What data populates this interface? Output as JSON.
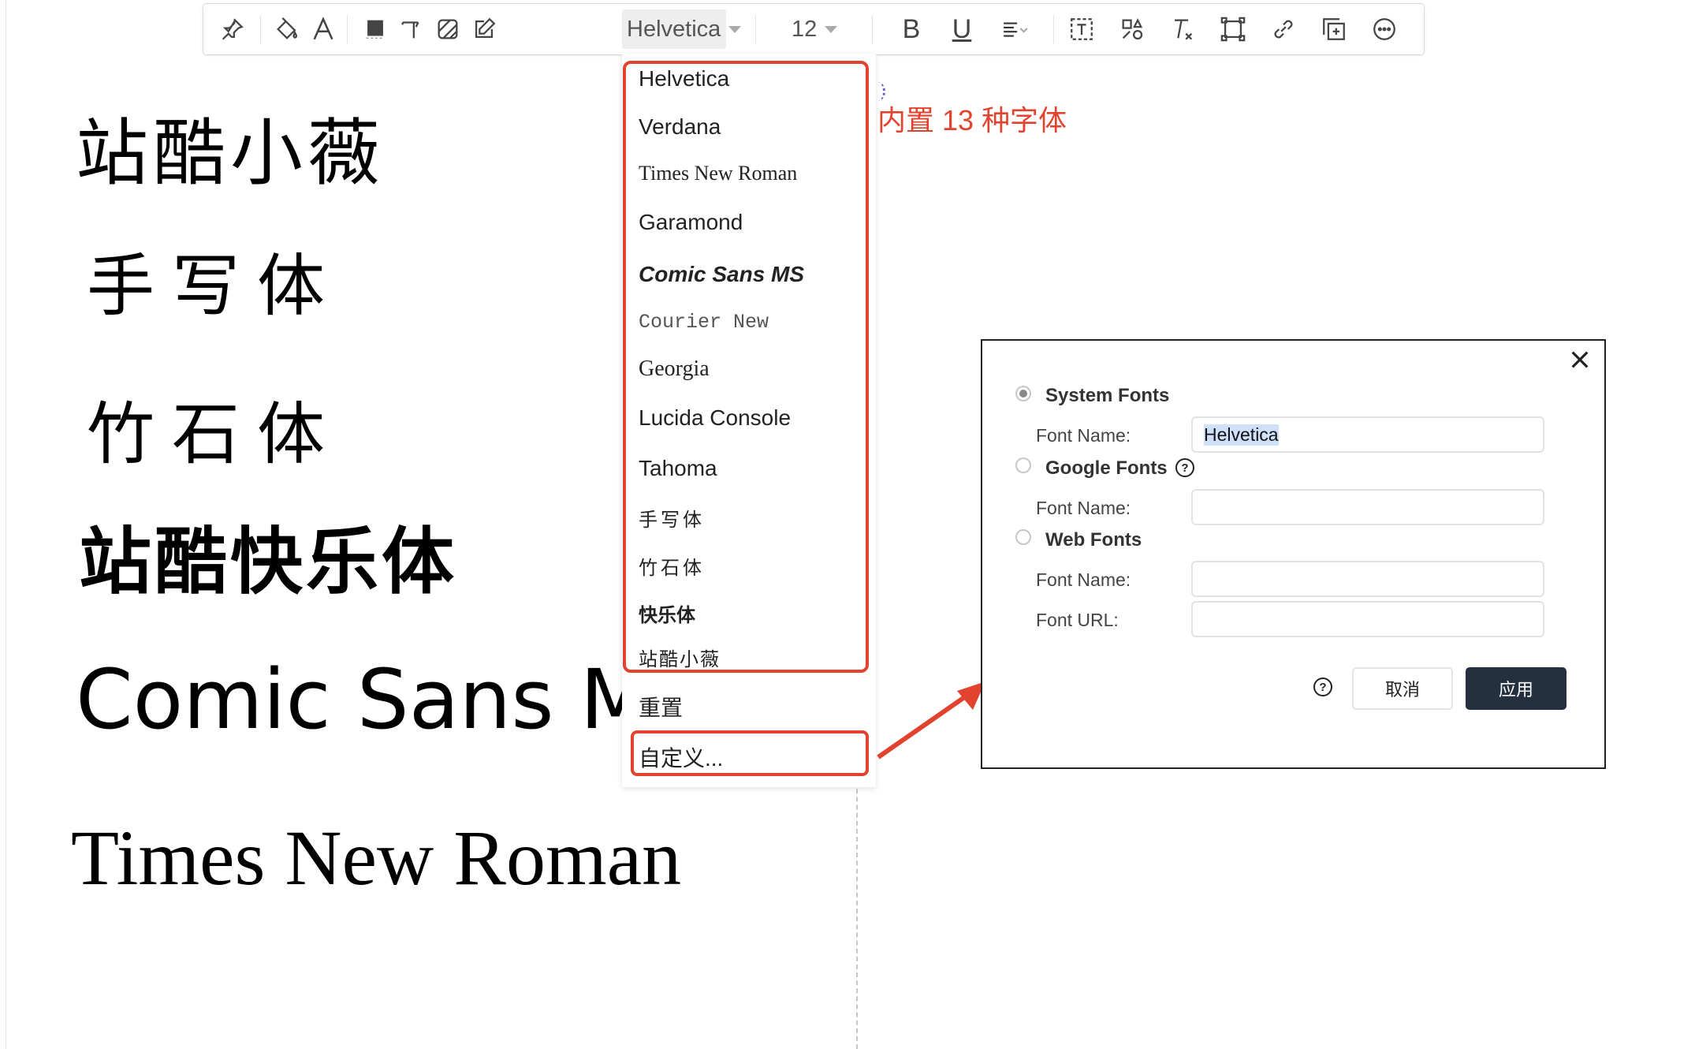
{
  "toolbar": {
    "font_value": "Helvetica",
    "size_value": "12",
    "bold_label": "B",
    "underline_label": "U",
    "icons": [
      "pin-icon",
      "paint-bucket-icon",
      "font-color-icon",
      "fill-square-icon",
      "text-style-icon",
      "pattern-icon",
      "edit-icon",
      "align-left-icon",
      "text-box-icon",
      "shapes-icon",
      "clear-format-icon",
      "frame-icon",
      "link-icon",
      "add-page-icon",
      "more-icon"
    ]
  },
  "canvas_samples": {
    "zhanku_xiaowei": "站酷小薇",
    "shouxieti": "手写体",
    "zhushiti": "竹石体",
    "zhanku_kuaile": "站酷快乐体",
    "comic": "Comic Sans MS",
    "times": "Times New Roman"
  },
  "dropdown": {
    "fonts": [
      "Helvetica",
      "Verdana",
      "Times New Roman",
      "Garamond",
      "Comic Sans MS",
      "Courier New",
      "Georgia",
      "Lucida Console",
      "Tahoma",
      "手写体",
      "竹石体",
      "快乐体",
      "站酷小薇"
    ],
    "reset_label": "重置",
    "custom_label": "自定义..."
  },
  "annotation": "内置 13 种字体",
  "dialog": {
    "system_fonts_label": "System Fonts",
    "google_fonts_label": "Google Fonts",
    "web_fonts_label": "Web Fonts",
    "font_name_label": "Font Name:",
    "font_url_label": "Font URL:",
    "system_font_value": "Helvetica",
    "help_glyph": "?",
    "cancel_label": "取消",
    "apply_label": "应用"
  },
  "colors": {
    "accent_red": "#e2432f",
    "apply_bg": "#243040"
  }
}
